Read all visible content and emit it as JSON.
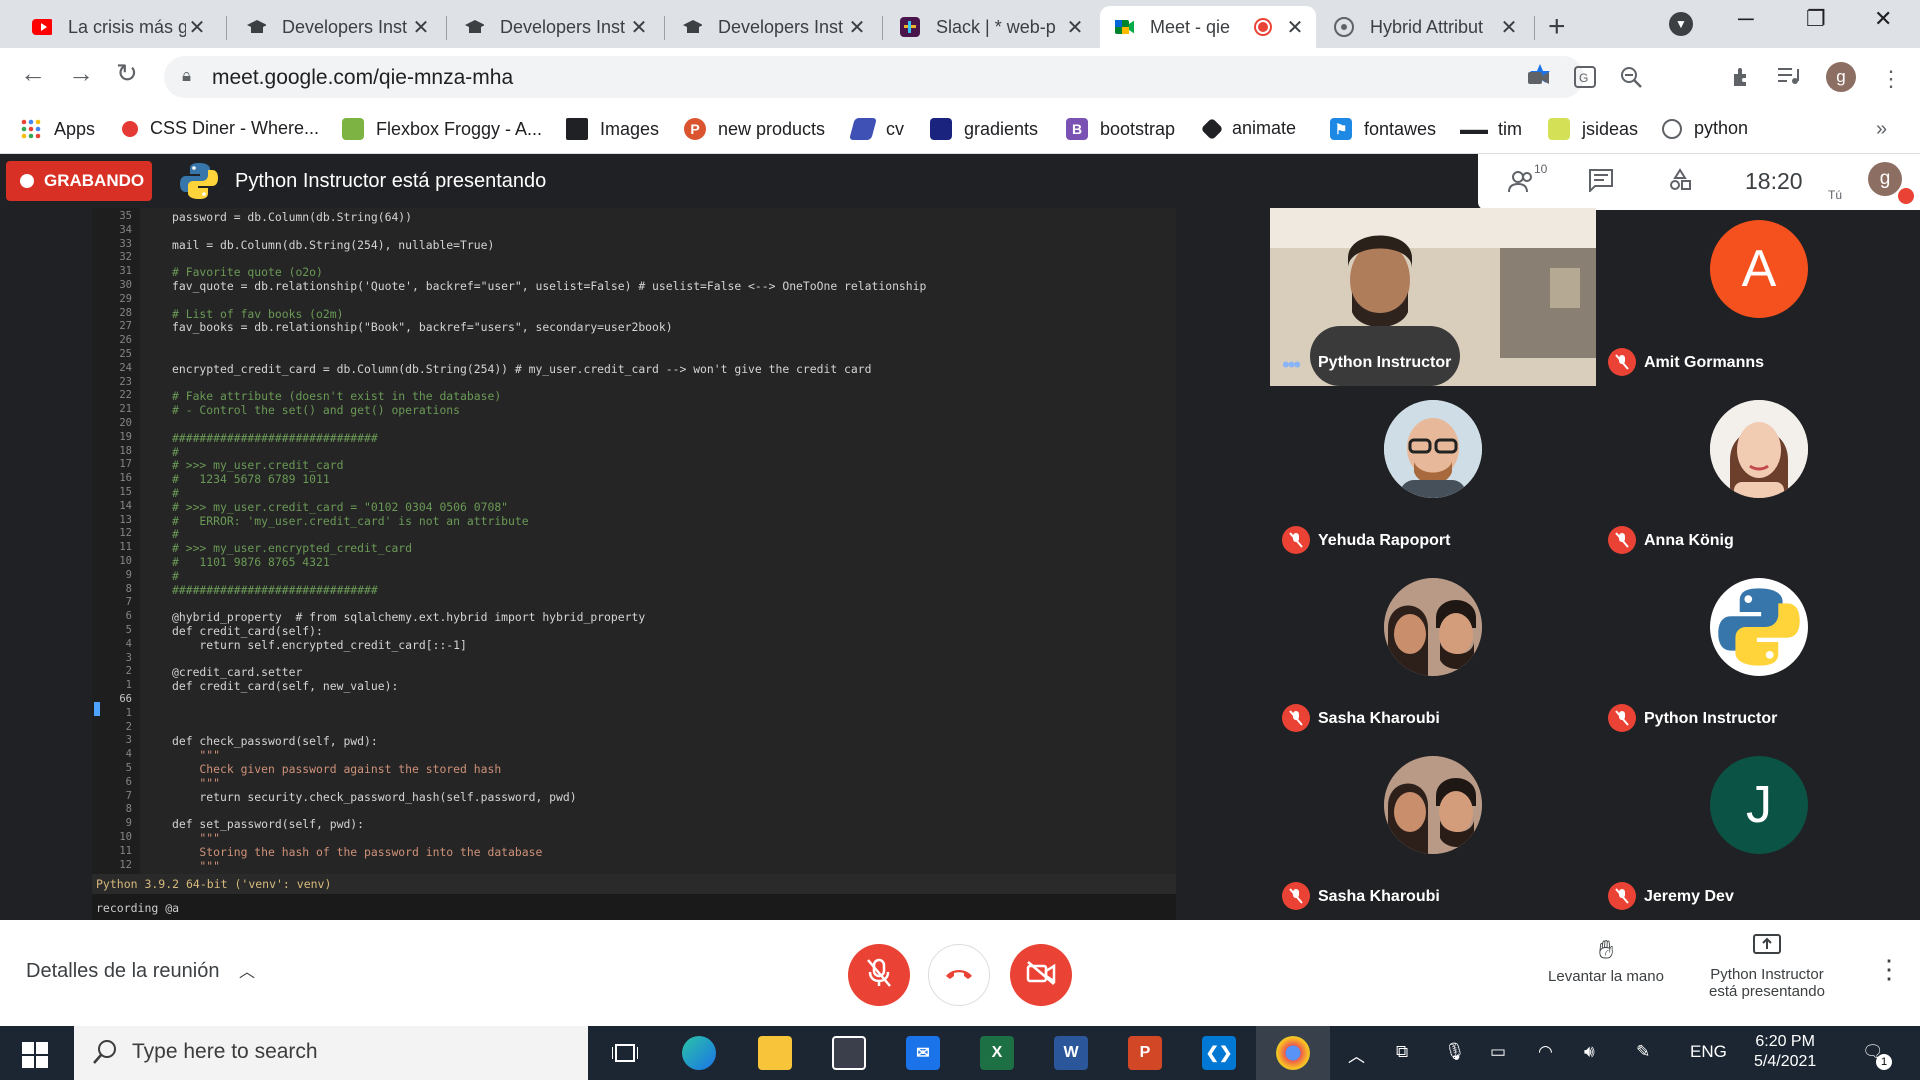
{
  "tabs": [
    {
      "label": "La crisis más gr",
      "icon": "youtube-icon"
    },
    {
      "label": "Developers Inst",
      "icon": "graduation-cap-icon"
    },
    {
      "label": "Developers Inst",
      "icon": "graduation-cap-icon"
    },
    {
      "label": "Developers Inst",
      "icon": "graduation-cap-icon"
    },
    {
      "label": "Slack | * web-p",
      "icon": "slack-icon"
    },
    {
      "label": "Meet - qie",
      "icon": "meet-icon",
      "active": true
    },
    {
      "label": "Hybrid Attribut",
      "icon": "globe-icon"
    }
  ],
  "address": {
    "url": "meet.google.com/qie-mnza-mha"
  },
  "profile_initial": "g",
  "bookmarks": [
    {
      "label": "Apps",
      "icon": "apps-grid-icon"
    },
    {
      "label": "CSS Diner - Where...",
      "icon": "css-diner-icon"
    },
    {
      "label": "Flexbox Froggy - A...",
      "icon": "frog-icon"
    },
    {
      "label": "Images",
      "icon": "images-icon"
    },
    {
      "label": "new products",
      "icon": "producthunt-icon"
    },
    {
      "label": "cv",
      "icon": "bookmark-icon"
    },
    {
      "label": "gradients",
      "icon": "gradient-icon"
    },
    {
      "label": "bootstrap",
      "icon": "bootstrap-icon"
    },
    {
      "label": "animate",
      "icon": "animate-icon"
    },
    {
      "label": "fontawes",
      "icon": "flag-icon"
    },
    {
      "label": "tim",
      "icon": "glasses-icon"
    },
    {
      "label": "jsideas",
      "icon": "jsideas-icon"
    },
    {
      "label": "python",
      "icon": "python-icon"
    }
  ],
  "meet": {
    "recording_label": "GRABANDO",
    "presenter_text": "Python Instructor está presentando",
    "participant_count": "10",
    "time": "18:20",
    "self_label": "Tú",
    "self_initial": "g"
  },
  "code": {
    "lines": [
      {
        "n": "35",
        "text": "password = db.Column(db.String(64))"
      },
      {
        "n": "34",
        "text": ""
      },
      {
        "n": "33",
        "text": "mail = db.Column(db.String(254), nullable=True)"
      },
      {
        "n": "32",
        "text": ""
      },
      {
        "n": "31",
        "text": "# Favorite quote (o2o)"
      },
      {
        "n": "30",
        "text": "fav_quote = db.relationship('Quote', backref=\"user\", uselist=False) # uselist=False <--> OneToOne relationship"
      },
      {
        "n": "29",
        "text": ""
      },
      {
        "n": "28",
        "text": "# List of fav books (o2m)"
      },
      {
        "n": "27",
        "text": "fav_books = db.relationship(\"Book\", backref=\"users\", secondary=user2book)"
      },
      {
        "n": "26",
        "text": ""
      },
      {
        "n": "25",
        "text": ""
      },
      {
        "n": "24",
        "text": "encrypted_credit_card = db.Column(db.String(254)) # my_user.credit_card --> won't give the credit card"
      },
      {
        "n": "23",
        "text": ""
      },
      {
        "n": "22",
        "text": "# Fake attribute (doesn't exist in the database)"
      },
      {
        "n": "21",
        "text": "# - Control the set() and get() operations"
      },
      {
        "n": "20",
        "text": ""
      },
      {
        "n": "19",
        "text": "##############################"
      },
      {
        "n": "18",
        "text": "#"
      },
      {
        "n": "17",
        "text": "# >>> my_user.credit_card"
      },
      {
        "n": "16",
        "text": "#   1234 5678 6789 1011"
      },
      {
        "n": "15",
        "text": "#"
      },
      {
        "n": "14",
        "text": "# >>> my_user.credit_card = \"0102 0304 0506 0708\""
      },
      {
        "n": "13",
        "text": "#   ERROR: 'my_user.credit_card' is not an attribute"
      },
      {
        "n": "12",
        "text": "#"
      },
      {
        "n": "11",
        "text": "# >>> my_user.encrypted_credit_card"
      },
      {
        "n": "10",
        "text": "#   1101 9876 8765 4321"
      },
      {
        "n": "9",
        "text": "#"
      },
      {
        "n": "8",
        "text": "##############################"
      },
      {
        "n": "7",
        "text": ""
      },
      {
        "n": "6",
        "text": "@hybrid_property  # from sqlalchemy.ext.hybrid import hybrid_property"
      },
      {
        "n": "5",
        "text": "def credit_card(self):"
      },
      {
        "n": "4",
        "text": "    return self.encrypted_credit_card[::-1]"
      },
      {
        "n": "3",
        "text": ""
      },
      {
        "n": "2",
        "text": "@credit_card.setter"
      },
      {
        "n": "1",
        "text": "def credit_card(self, new_value):"
      },
      {
        "n": "66",
        "text": ""
      },
      {
        "n": "1",
        "text": ""
      },
      {
        "n": "2",
        "text": ""
      },
      {
        "n": "3",
        "text": "def check_password(self, pwd):"
      },
      {
        "n": "4",
        "text": "    \"\"\""
      },
      {
        "n": "5",
        "text": "    Check given password against the stored hash"
      },
      {
        "n": "6",
        "text": "    \"\"\""
      },
      {
        "n": "7",
        "text": "    return security.check_password_hash(self.password, pwd)"
      },
      {
        "n": "8",
        "text": ""
      },
      {
        "n": "9",
        "text": "def set_password(self, pwd):"
      },
      {
        "n": "10",
        "text": "    \"\"\""
      },
      {
        "n": "11",
        "text": "    Storing the hash of the password into the database"
      },
      {
        "n": "12",
        "text": "    \"\"\""
      }
    ],
    "status": "Python 3.9.2 64-bit ('venv': venv)",
    "command": "recording @a"
  },
  "participants": [
    {
      "name": "Python Instructor",
      "type": "video",
      "speaking": true
    },
    {
      "name": "Amit Gormanns",
      "initial": "A",
      "color": "#f4511e"
    },
    {
      "name": "Yehuda Rapoport",
      "type": "photo"
    },
    {
      "name": "Anna König",
      "type": "photo"
    },
    {
      "name": "Sasha Kharoubi",
      "type": "photo"
    },
    {
      "name": "Python Instructor",
      "type": "python-logo"
    },
    {
      "name": "Sasha Kharoubi",
      "type": "photo"
    },
    {
      "name": "Jeremy Dev",
      "initial": "J",
      "color": "#0b5345"
    }
  ],
  "bottom": {
    "details_label": "Detalles de la reunión",
    "raise_hand_label": "Levantar la mano",
    "presenting_label": "Python Instructor está presentando"
  },
  "taskbar": {
    "search_placeholder": "Type here to search",
    "language": "ENG",
    "time": "6:20 PM",
    "date": "5/4/2021",
    "notification_count": "1"
  },
  "colors": {
    "red": "#ea4335",
    "recording": "#d93025",
    "python_blue": "#3776ab",
    "python_yellow": "#ffd43b"
  }
}
